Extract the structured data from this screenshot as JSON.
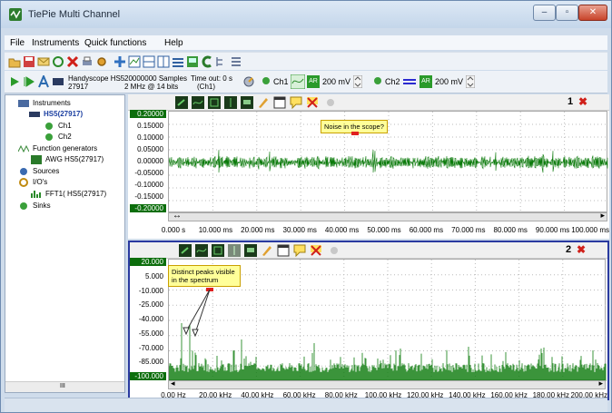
{
  "window": {
    "title": "TiePie Multi Channel",
    "min": "–",
    "max": "▫",
    "close": "✕"
  },
  "menu": {
    "items": [
      "File",
      "Instruments",
      "Quick functions",
      "Help"
    ]
  },
  "toolbar2": {
    "device_name": "Handyscope HS5",
    "device_serial": "27917",
    "samples": "20000000 Samples",
    "rate": "2 MHz @ 14 bits",
    "timeout": "Time out: 0 s",
    "channel_ref": "(Ch1)",
    "ch1_label": "Ch1",
    "ch1_range": "200 mV",
    "ch2_label": "Ch2",
    "ch2_range": "200 mV",
    "ar": "AR"
  },
  "tree": {
    "instruments": "Instruments",
    "hs5": "HS5(27917)",
    "ch1": "Ch1",
    "ch2": "Ch2",
    "function_generators": "Function generators",
    "awg": "AWG HS5(27917)",
    "sources": "Sources",
    "ios": "I/O's",
    "fft": "FFT1( HS5(27917)",
    "sinks": "Sinks",
    "scroll_mark": "III"
  },
  "scope1": {
    "number": "1",
    "note": "Noise in the scope?",
    "y_labels": [
      "0.20000",
      "0.15000",
      "0.10000",
      "0.05000",
      "0.00000",
      "-0.05000",
      "-0.10000",
      "-0.15000",
      "-0.20000"
    ],
    "x_labels": [
      "0.000 s",
      "10.000 ms",
      "20.000 ms",
      "30.000 ms",
      "40.000 ms",
      "50.000 ms",
      "60.000 ms",
      "70.000 ms",
      "80.000 ms",
      "90.000 ms",
      "100.000 ms"
    ]
  },
  "scope2": {
    "number": "2",
    "note": "Distinct peaks visible in the spectrum",
    "y_labels": [
      "20.000",
      "5.000",
      "-10.000",
      "-25.000",
      "-40.000",
      "-55.000",
      "-70.000",
      "-85.000",
      "-100.000"
    ],
    "x_labels": [
      "0.00 Hz",
      "20.00 kHz",
      "40.00 kHz",
      "60.00 kHz",
      "80.00 kHz",
      "100.00 kHz",
      "120.00 kHz",
      "140.00 kHz",
      "160.00 kHz",
      "180.00 kHz",
      "200.00 kHz"
    ]
  },
  "colors": {
    "signal": "#0a7a0a",
    "accent": "#2a4fa0",
    "close_red": "#d0201a"
  }
}
